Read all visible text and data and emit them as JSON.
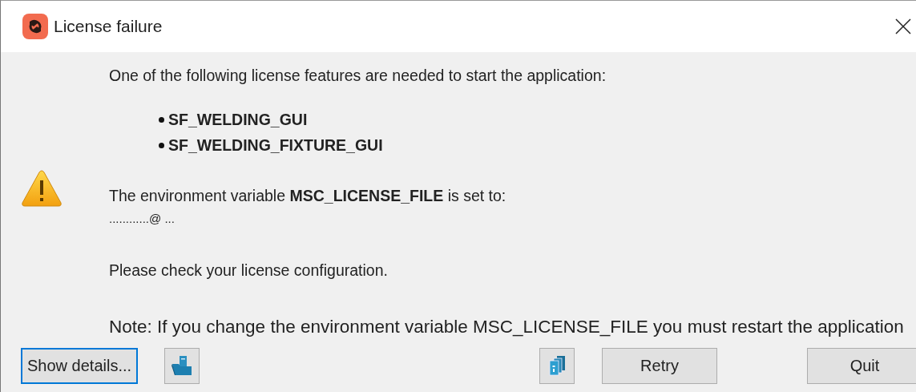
{
  "window": {
    "title": "License failure"
  },
  "intro": "One of the following license features are needed to start the application:",
  "features": [
    "SF_WELDING_GUI",
    "SF_WELDING_FIXTURE_GUI"
  ],
  "env_line": "The environment variable **MSC_LICENSE_FILE** is set to:",
  "env_value": "............@ ...",
  "check": "Please check your license configuration.",
  "note": "Note: If you change the environment variable MSC_LICENSE_FILE you must restart the application",
  "buttons": {
    "details": "Show details...",
    "retry": "Retry",
    "quit": "Quit"
  }
}
